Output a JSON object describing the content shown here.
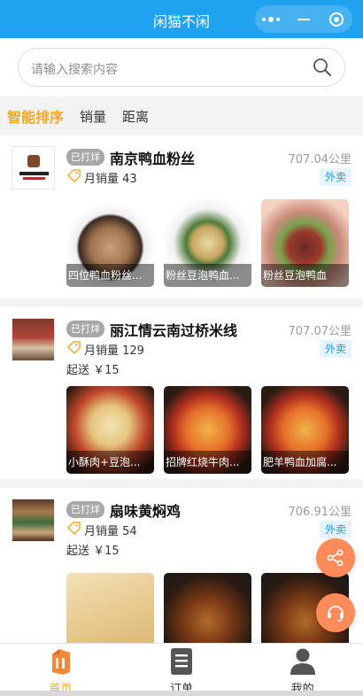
{
  "topbar": {
    "title": "闲猫不闲"
  },
  "search": {
    "placeholder": "请输入搜索内容"
  },
  "sort_tabs": [
    {
      "label": "智能排序",
      "active": true
    },
    {
      "label": "销量",
      "active": false
    },
    {
      "label": "距离",
      "active": false
    }
  ],
  "shops": [
    {
      "badge": "已打烊",
      "name": "南京鸭血粉丝",
      "distance": "707.04公里",
      "sales": "月销量 43",
      "delivery": "外卖",
      "min_send": "",
      "dishes": [
        "四位鸭血粉丝...",
        "粉丝豆泡鸭血...",
        "粉丝豆泡鸭血"
      ]
    },
    {
      "badge": "已打烊",
      "name": "丽江情云南过桥米线",
      "distance": "707.07公里",
      "sales": "月销量 129",
      "delivery": "外卖",
      "min_send": "起送 ￥15",
      "dishes": [
        "小酥肉+豆泡...",
        "招牌红烧牛肉...",
        "肥羊鸭血加腐..."
      ]
    },
    {
      "badge": "已打烊",
      "name": "扇味黄焖鸡",
      "distance": "706.91公里",
      "sales": "月销量 54",
      "delivery": "外卖",
      "min_send": "起送 ￥15",
      "dishes": [
        "",
        "",
        ""
      ]
    }
  ],
  "bottom_nav": [
    {
      "label": "首页",
      "icon": "home-bag-icon",
      "active": true
    },
    {
      "label": "订单",
      "icon": "order-list-icon",
      "active": false
    },
    {
      "label": "我的",
      "icon": "user-icon",
      "active": false
    }
  ],
  "colors": {
    "primary": "#1fa2f0",
    "accent": "#f5a623",
    "fab": "#ff8a5a",
    "delivery_text": "#1f9be6"
  }
}
